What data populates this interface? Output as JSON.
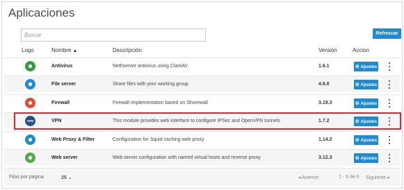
{
  "page": {
    "title": "Aplicaciones"
  },
  "search": {
    "placeholder": "Buscar"
  },
  "toolbar": {
    "refresh_label": "Refrescar"
  },
  "table": {
    "headers": {
      "logo": "Logo",
      "name": "Nombre",
      "description": "Descripción",
      "version": "Versión",
      "action": "Accion"
    },
    "sort_icon": "▲",
    "rows": [
      {
        "name": "Antivirus",
        "description": "Nethserver antivirus using ClamAV",
        "version": "1.6.1",
        "action_label": "Ajustes",
        "icon": "bug-icon",
        "color": "#2e9c3a"
      },
      {
        "name": "File server",
        "description": "Share files with your working group",
        "version": "4.6.0",
        "action_label": "Ajustes",
        "icon": "drive-icon",
        "color": "#1f8ad8"
      },
      {
        "name": "Firewall",
        "description": "Firewall implementation based on Shorewall",
        "version": "3.19.3",
        "action_label": "Ajustes",
        "icon": "lock-icon",
        "color": "#e24b30"
      },
      {
        "name": "VPN",
        "description": "This module provides web interface to configure IPSec and OpenVPN tunnels",
        "version": "1.7.2",
        "action_label": "Ajustes",
        "icon": "vpn-shield-icon",
        "color": "#2a4e8c",
        "icon_text": "VPN"
      },
      {
        "name": "Web Proxy & Filter",
        "description": "Configuration for Squid caching web proxy",
        "version": "1.14.2",
        "action_label": "Ajustes",
        "icon": "shield-icon",
        "color": "#1c8ec7"
      },
      {
        "name": "Web server",
        "description": "Web server configuration with named virtual hosts and reverse proxy",
        "version": "3.12.3",
        "action_label": "Ajustes",
        "icon": "globe-icon",
        "color": "#57a84b"
      }
    ]
  },
  "footer": {
    "rows_per_page_label": "Filas por pagina",
    "rows_per_page_value": "25",
    "prev_label": "Anterior",
    "range_label": "1 - 6 de 6",
    "next_label": "Siguiente"
  },
  "colors": {
    "accent": "#1d8ad3",
    "highlight": "#d9272e"
  }
}
